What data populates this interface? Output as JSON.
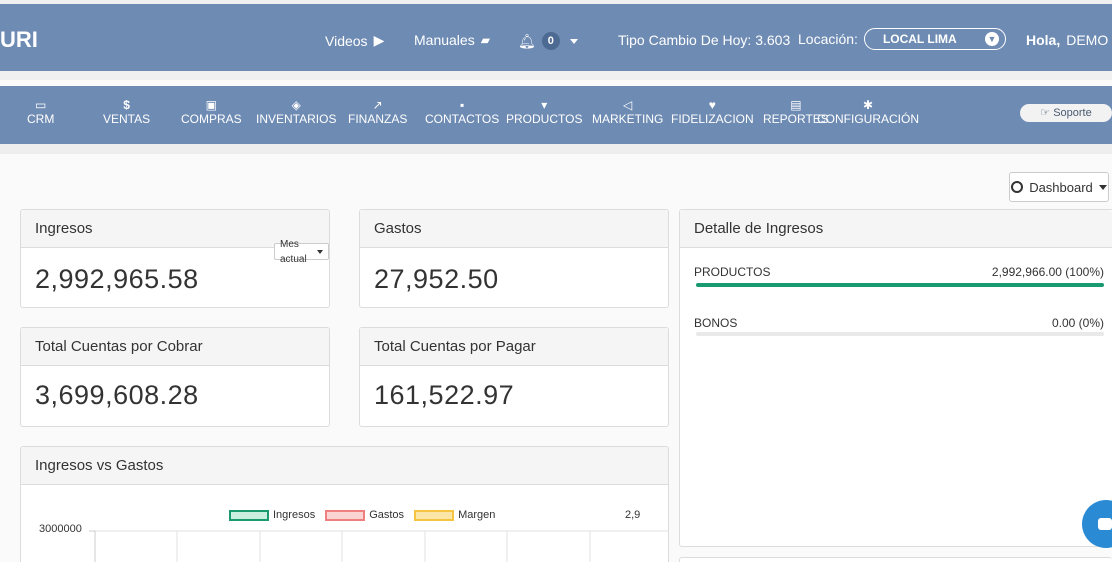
{
  "topbar": {
    "logo": "URI",
    "videos_label": "Videos",
    "manuales_label": "Manuales",
    "notifications_count": "0",
    "tipo_cambio": "Tipo Cambio De Hoy: 3.603",
    "location_label": "Locación:",
    "location_value": "LOCAL LIMA",
    "greeting_bold": "Hola,",
    "greeting_user": "DEMO"
  },
  "nav": {
    "items": [
      {
        "label": "CRM",
        "icon": "monitor-icon"
      },
      {
        "label": "VENTAS",
        "icon": "dollar-icon"
      },
      {
        "label": "COMPRAS",
        "icon": "money-icon"
      },
      {
        "label": "INVENTARIOS",
        "icon": "cubes-icon"
      },
      {
        "label": "FINANZAS",
        "icon": "chart-line-icon"
      },
      {
        "label": "CONTACTOS",
        "icon": "address-book-icon"
      },
      {
        "label": "PRODUCTOS",
        "icon": "cart-icon"
      },
      {
        "label": "MARKETING",
        "icon": "bullhorn-icon"
      },
      {
        "label": "FIDELIZACION",
        "icon": "heart-icon"
      },
      {
        "label": "REPORTES",
        "icon": "file-icon"
      },
      {
        "label": "CONFIGURACIÓN",
        "icon": "gear-icon"
      }
    ],
    "support_label": "Soporte"
  },
  "dashboard_button": "Dashboard",
  "ingresos": {
    "title": "Ingresos",
    "value": "2,992,965.58",
    "period": "Mes actual"
  },
  "gastos": {
    "title": "Gastos",
    "value": "27,952.50"
  },
  "cobrar": {
    "title": "Total Cuentas por Cobrar",
    "value": "3,699,608.28"
  },
  "pagar": {
    "title": "Total Cuentas por Pagar",
    "value": "161,522.97"
  },
  "detalle": {
    "title": "Detalle de Ingresos",
    "rows": [
      {
        "label": "PRODUCTOS",
        "value": "2,992,966.00 (100%)",
        "fraction": 1.0
      },
      {
        "label": "BONOS",
        "value": "0.00 (0%)",
        "fraction": 0.0
      }
    ]
  },
  "chart_panel": {
    "title": "Ingresos vs Gastos",
    "partial_label": "2,9"
  },
  "chart_data": {
    "type": "bar",
    "series": [
      {
        "name": "Ingresos",
        "color": "#1a9a70"
      },
      {
        "name": "Gastos",
        "color": "#f08080"
      },
      {
        "name": "Margen",
        "color": "#f5c542"
      }
    ],
    "yticks": [
      "3000000"
    ]
  },
  "colors": {
    "header": "#6e8bb3",
    "accent_green": "#1a9a70",
    "fab": "#2a8ad4"
  }
}
